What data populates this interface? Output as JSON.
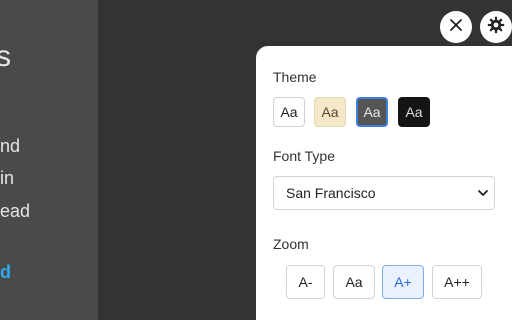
{
  "reader": {
    "title_fragment": "s",
    "lines": [
      "nd",
      "in",
      "ead"
    ],
    "link_fragment": "d"
  },
  "toolbar": {
    "close_symbol": "✕",
    "settings_symbol": "⚙"
  },
  "settings": {
    "theme": {
      "label": "Theme",
      "options": [
        {
          "name": "light",
          "text": "Aa",
          "background": "#ffffff"
        },
        {
          "name": "sepia",
          "text": "Aa",
          "background": "#f4e8c8"
        },
        {
          "name": "gray",
          "text": "Aa",
          "background": "#555555",
          "selected": true
        },
        {
          "name": "dark",
          "text": "Aa",
          "background": "#141414"
        }
      ]
    },
    "font_type": {
      "label": "Font Type",
      "selected": "San Francisco"
    },
    "zoom": {
      "label": "Zoom",
      "options": [
        {
          "text": "A-"
        },
        {
          "text": "Aa"
        },
        {
          "text": "A+",
          "selected": true
        },
        {
          "text": "A++"
        }
      ]
    }
  },
  "colors": {
    "background": "#333333",
    "accent": "#2b6fd6",
    "link": "#2fa8f0"
  }
}
